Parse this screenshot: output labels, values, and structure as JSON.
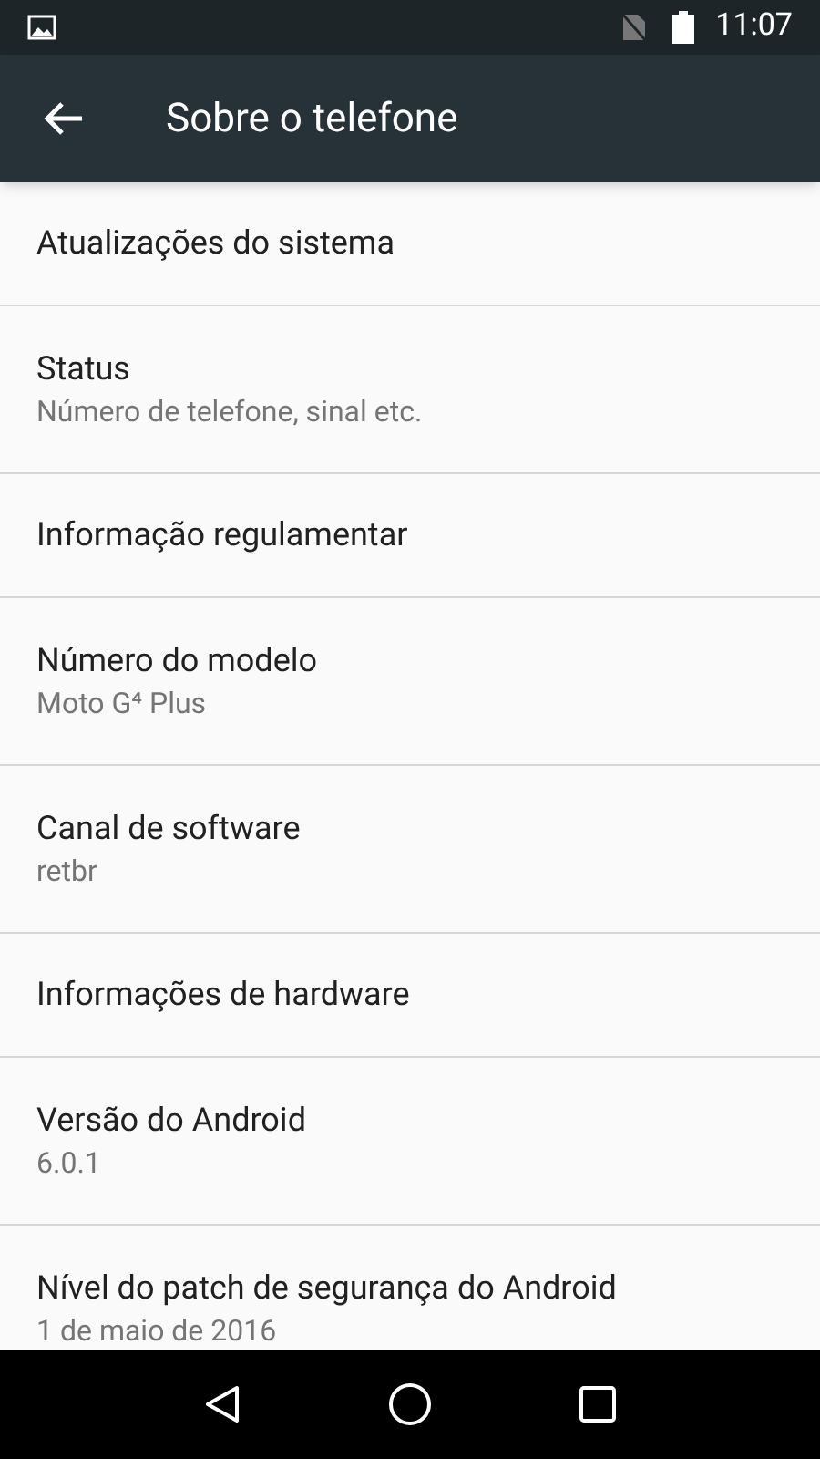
{
  "status_bar": {
    "time": "11:07"
  },
  "app_bar": {
    "title": "Sobre o telefone"
  },
  "items": [
    {
      "title": "Atualizações do sistema"
    },
    {
      "title": "Status",
      "subtitle": "Número de telefone, sinal etc."
    },
    {
      "title": "Informação regulamentar"
    },
    {
      "title": "Número do modelo",
      "subtitle": "Moto G⁴ Plus"
    },
    {
      "title": "Canal de software",
      "subtitle": "retbr"
    },
    {
      "title": "Informações de hardware"
    },
    {
      "title": "Versão do Android",
      "subtitle": "6.0.1"
    },
    {
      "title": "Nível do patch de segurança do Android",
      "subtitle": "1 de maio de 2016"
    }
  ]
}
